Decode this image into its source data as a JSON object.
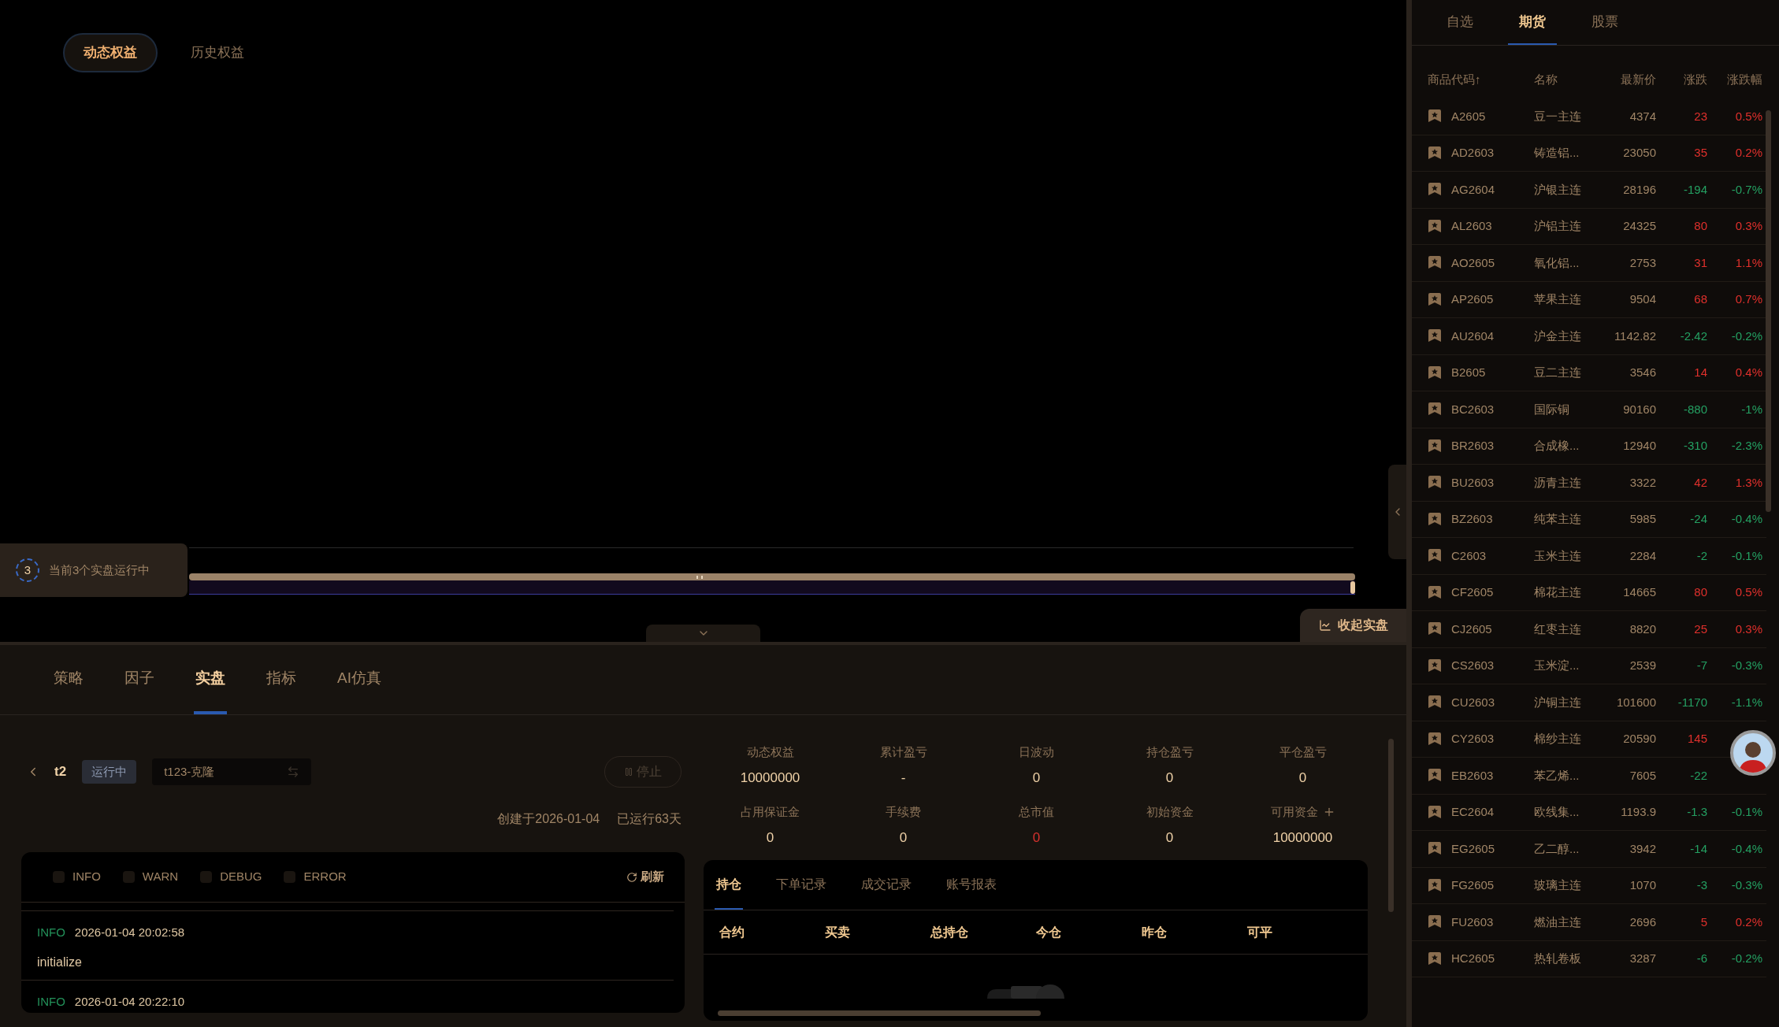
{
  "chart_tabs": [
    {
      "label": "动态权益",
      "selected": true
    },
    {
      "label": "历史权益",
      "selected": false
    }
  ],
  "running": {
    "count": "3",
    "text": "当前3个实盘运行中"
  },
  "range_slider": {
    "level": 1
  },
  "collapse_button": "收起实盘",
  "main_tabs": [
    {
      "label": "策略",
      "selected": false
    },
    {
      "label": "因子",
      "selected": false
    },
    {
      "label": "实盘",
      "selected": true
    },
    {
      "label": "指标",
      "selected": false
    },
    {
      "label": "AI仿真",
      "selected": false
    }
  ],
  "live": {
    "name": "t2",
    "status": "运行中",
    "strategy": "t123-克隆",
    "stop_button": "停止",
    "created": "创建于2026-01-04",
    "running_days": "已运行63天"
  },
  "log": {
    "filters": [
      {
        "label": "INFO",
        "checked": false
      },
      {
        "label": "WARN",
        "checked": false
      },
      {
        "label": "DEBUG",
        "checked": false
      },
      {
        "label": "ERROR",
        "checked": false
      }
    ],
    "refresh": "刷新",
    "entries": [
      {
        "level": "INFO",
        "time": "2026-01-04 20:02:58",
        "message": "initialize"
      },
      {
        "level": "INFO",
        "time": "2026-01-04 20:22:10"
      }
    ]
  },
  "stats": [
    {
      "label": "动态权益",
      "value": "10000000",
      "color": "#f0d2a8",
      "addable": false
    },
    {
      "label": "累计盈亏",
      "value": "-",
      "color": "#f0d2a8",
      "addable": false
    },
    {
      "label": "日波动",
      "value": "0",
      "color": "#f0d2a8",
      "addable": false
    },
    {
      "label": "持仓盈亏",
      "value": "0",
      "color": "#f0d2a8",
      "addable": false
    },
    {
      "label": "平仓盈亏",
      "value": "0",
      "color": "#f0d2a8",
      "addable": false
    },
    {
      "label": "占用保证金",
      "value": "0",
      "color": "#f0d2a8",
      "addable": false
    },
    {
      "label": "手续费",
      "value": "0",
      "color": "#f0d2a8",
      "addable": false
    },
    {
      "label": "总市值",
      "value": "0",
      "color": "#d8322e",
      "addable": false
    },
    {
      "label": "初始资金",
      "value": "0",
      "color": "#f0d2a8",
      "addable": false
    },
    {
      "label": "可用资金",
      "value": "10000000",
      "color": "#f0d2a8",
      "addable": true
    }
  ],
  "positions": {
    "tabs": [
      {
        "label": "持仓",
        "selected": true
      },
      {
        "label": "下单记录",
        "selected": false
      },
      {
        "label": "成交记录",
        "selected": false
      },
      {
        "label": "账号报表",
        "selected": false
      }
    ],
    "columns": [
      "合约",
      "买卖",
      "总持仓",
      "今仓",
      "昨仓",
      "可平"
    ]
  },
  "market": {
    "tabs": [
      {
        "label": "自选",
        "selected": false
      },
      {
        "label": "期货",
        "selected": true
      },
      {
        "label": "股票",
        "selected": false
      }
    ],
    "columns": [
      "商品代码↑",
      "名称",
      "最新价",
      "涨跌",
      "涨跌幅"
    ],
    "rows": [
      {
        "code": "A2605",
        "name": "豆一主连",
        "price": "4374",
        "change": "23",
        "pct": "0.5%",
        "color": "#e0302c"
      },
      {
        "code": "AD2603",
        "name": "铸造铝...",
        "price": "23050",
        "change": "35",
        "pct": "0.2%",
        "color": "#e0302c"
      },
      {
        "code": "AG2604",
        "name": "沪银主连",
        "price": "28196",
        "change": "-194",
        "pct": "-0.7%",
        "color": "#24a062"
      },
      {
        "code": "AL2603",
        "name": "沪铝主连",
        "price": "24325",
        "change": "80",
        "pct": "0.3%",
        "color": "#e0302c"
      },
      {
        "code": "AO2605",
        "name": "氧化铝...",
        "price": "2753",
        "change": "31",
        "pct": "1.1%",
        "color": "#e0302c"
      },
      {
        "code": "AP2605",
        "name": "苹果主连",
        "price": "9504",
        "change": "68",
        "pct": "0.7%",
        "color": "#e0302c"
      },
      {
        "code": "AU2604",
        "name": "沪金主连",
        "price": "1142.82",
        "change": "-2.42",
        "pct": "-0.2%",
        "color": "#24a062"
      },
      {
        "code": "B2605",
        "name": "豆二主连",
        "price": "3546",
        "change": "14",
        "pct": "0.4%",
        "color": "#e0302c"
      },
      {
        "code": "BC2603",
        "name": "国际铜",
        "price": "90160",
        "change": "-880",
        "pct": "-1%",
        "color": "#24a062"
      },
      {
        "code": "BR2603",
        "name": "合成橡...",
        "price": "12940",
        "change": "-310",
        "pct": "-2.3%",
        "color": "#24a062"
      },
      {
        "code": "BU2603",
        "name": "沥青主连",
        "price": "3322",
        "change": "42",
        "pct": "1.3%",
        "color": "#e0302c"
      },
      {
        "code": "BZ2603",
        "name": "纯苯主连",
        "price": "5985",
        "change": "-24",
        "pct": "-0.4%",
        "color": "#24a062"
      },
      {
        "code": "C2603",
        "name": "玉米主连",
        "price": "2284",
        "change": "-2",
        "pct": "-0.1%",
        "color": "#24a062"
      },
      {
        "code": "CF2605",
        "name": "棉花主连",
        "price": "14665",
        "change": "80",
        "pct": "0.5%",
        "color": "#e0302c"
      },
      {
        "code": "CJ2605",
        "name": "红枣主连",
        "price": "8820",
        "change": "25",
        "pct": "0.3%",
        "color": "#e0302c"
      },
      {
        "code": "CS2603",
        "name": "玉米淀...",
        "price": "2539",
        "change": "-7",
        "pct": "-0.3%",
        "color": "#24a062"
      },
      {
        "code": "CU2603",
        "name": "沪铜主连",
        "price": "101600",
        "change": "-1170",
        "pct": "-1.1%",
        "color": "#24a062"
      },
      {
        "code": "CY2603",
        "name": "棉纱主连",
        "price": "20590",
        "change": "145",
        "color": "#e0302c"
      },
      {
        "code": "EB2603",
        "name": "苯乙烯...",
        "price": "7605",
        "change": "-22",
        "color": "#24a062"
      },
      {
        "code": "EC2604",
        "name": "欧线集...",
        "price": "1193.9",
        "change": "-1.3",
        "pct": "-0.1%",
        "color": "#24a062"
      },
      {
        "code": "EG2605",
        "name": "乙二醇...",
        "price": "3942",
        "change": "-14",
        "pct": "-0.4%",
        "color": "#24a062"
      },
      {
        "code": "FG2605",
        "name": "玻璃主连",
        "price": "1070",
        "change": "-3",
        "pct": "-0.3%",
        "color": "#24a062"
      },
      {
        "code": "FU2603",
        "name": "燃油主连",
        "price": "2696",
        "change": "5",
        "pct": "0.2%",
        "color": "#e0302c"
      },
      {
        "code": "HC2605",
        "name": "热轧卷板",
        "price": "3287",
        "change": "-6",
        "pct": "-0.2%",
        "color": "#24a062"
      }
    ]
  }
}
